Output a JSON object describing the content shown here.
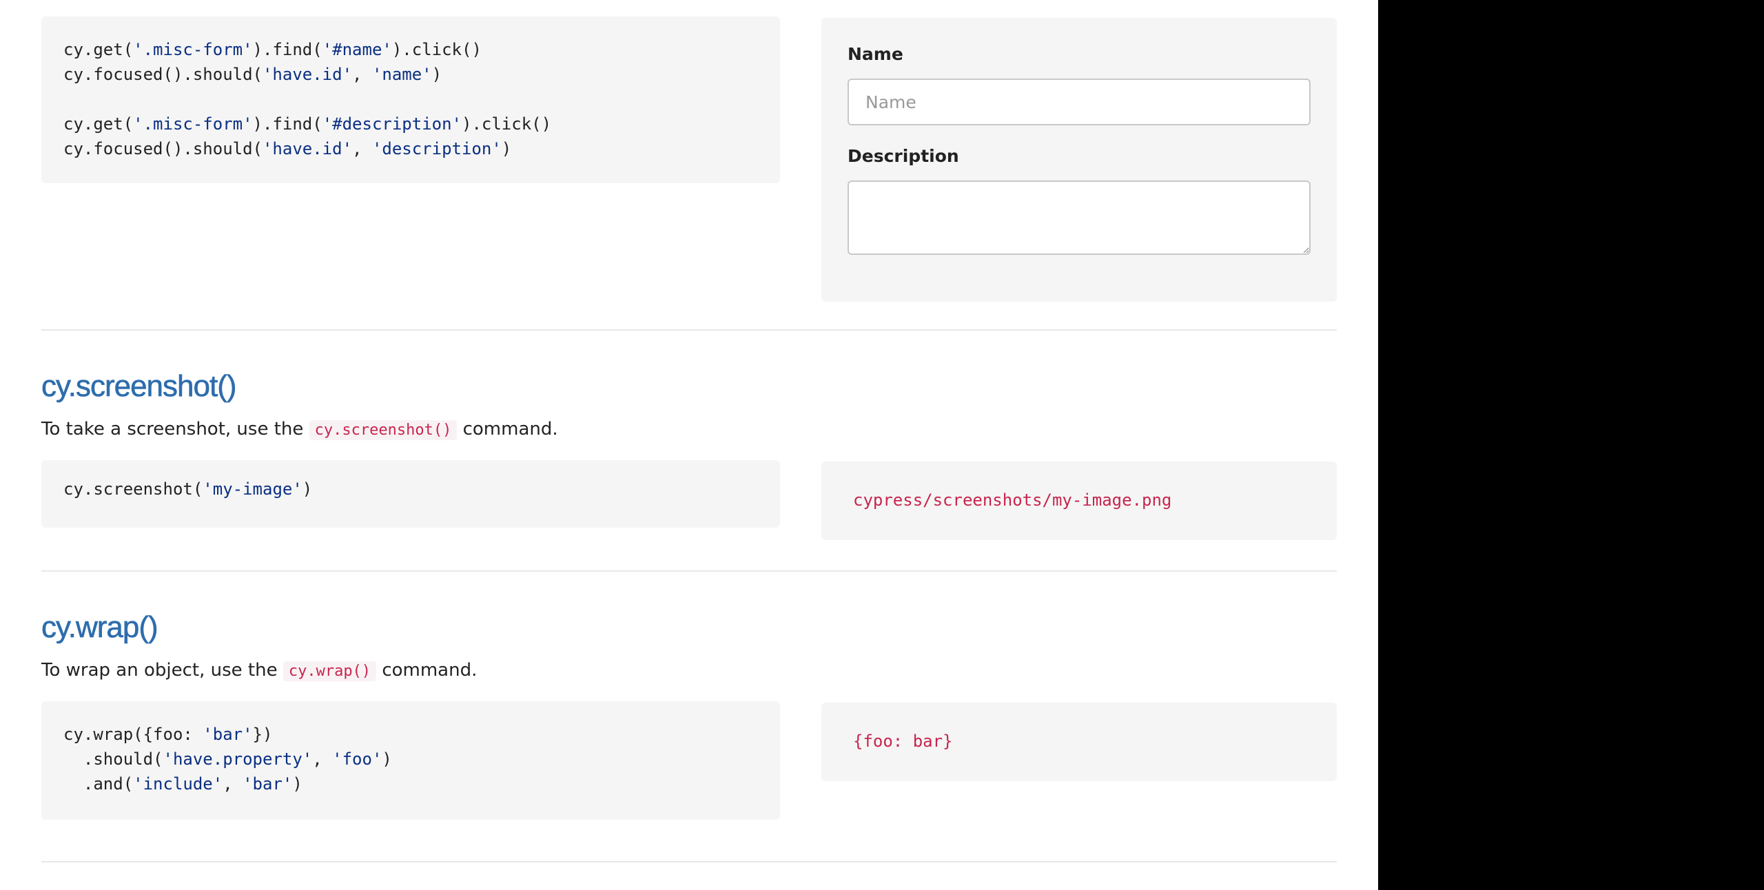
{
  "focused_example": {
    "code_lines": [
      [
        "cy.get(",
        "'.misc-form'",
        ").find(",
        "'#name'",
        ").click()"
      ],
      [
        "cy.focused().should(",
        "'have.id'",
        ", ",
        "'name'",
        ")"
      ],
      [],
      [
        "cy.get(",
        "'.misc-form'",
        ").find(",
        "'#description'",
        ").click()"
      ],
      [
        "cy.focused().should(",
        "'have.id'",
        ", ",
        "'description'",
        ")"
      ]
    ],
    "form": {
      "name_label": "Name",
      "name_placeholder": "Name",
      "description_label": "Description"
    }
  },
  "screenshot_section": {
    "title": "cy.screenshot()",
    "desc_before": "To take a screenshot, use the ",
    "desc_code": "cy.screenshot()",
    "desc_after": " command.",
    "code_lines": [
      [
        "cy.screenshot(",
        "'my-image'",
        ")"
      ]
    ],
    "result": "cypress/screenshots/my-image.png"
  },
  "wrap_section": {
    "title": "cy.wrap()",
    "desc_before": "To wrap an object, use the ",
    "desc_code": "cy.wrap()",
    "desc_after": " command.",
    "code_lines": [
      [
        "cy.wrap({foo: ",
        "'bar'",
        "})"
      ],
      [
        "  .should(",
        "'have.property'",
        ", ",
        "'foo'",
        ")"
      ],
      [
        "  .and(",
        "'include'",
        ", ",
        "'bar'",
        ")"
      ]
    ],
    "result": "{foo: bar}"
  }
}
